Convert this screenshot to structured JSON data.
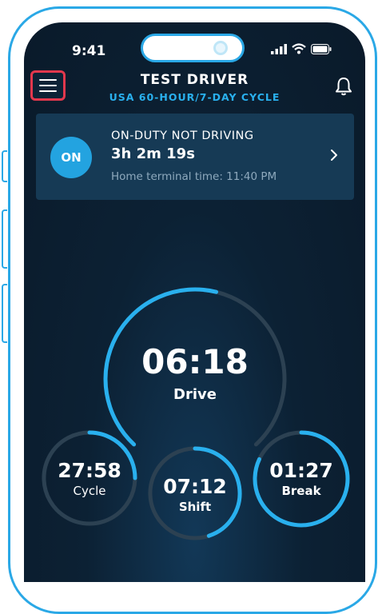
{
  "status_bar": {
    "time": "9:41"
  },
  "header": {
    "driver_name": "TEST DRIVER",
    "cycle": "USA 60-HOUR/7-DAY CYCLE",
    "menu_icon": "hamburger-menu-icon",
    "bell_icon": "bell-icon"
  },
  "duty_status": {
    "badge": "ON",
    "title": "ON-DUTY NOT DRIVING",
    "duration": "3h 2m 19s",
    "terminal_time": "Home terminal time: 11:40 PM"
  },
  "gauges": {
    "drive": {
      "value": "06:18",
      "label": "Drive",
      "progress": 0.55
    },
    "cycle": {
      "value": "27:58",
      "label": "Cycle",
      "progress": 0.25
    },
    "shift": {
      "value": "07:12",
      "label": "Shift",
      "progress": 0.45
    },
    "break": {
      "value": "01:27",
      "label": "Break",
      "progress": 0.82
    }
  },
  "colors": {
    "accent": "#29b0ee",
    "background": "#0c2134",
    "card": "#163a55",
    "track": "#2c4152",
    "highlight": "#e2384d"
  }
}
